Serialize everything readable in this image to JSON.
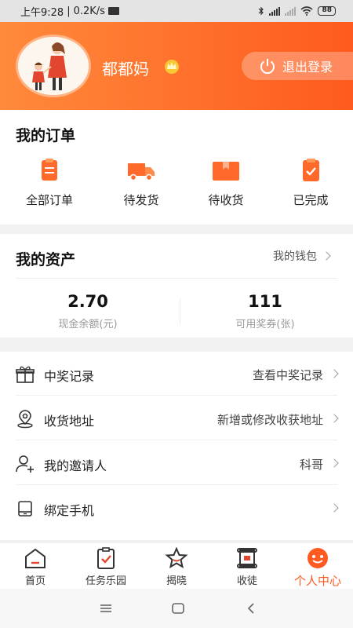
{
  "status_bar": {
    "time": "上午9:28",
    "speed": "0.2K/s",
    "battery": "88"
  },
  "profile": {
    "nickname": "都都妈",
    "logout_label": "退出登录"
  },
  "orders": {
    "title": "我的订单",
    "items": [
      {
        "label": "全部订单",
        "icon": "clipboard-icon"
      },
      {
        "label": "待发货",
        "icon": "truck-icon"
      },
      {
        "label": "待收货",
        "icon": "package-icon"
      },
      {
        "label": "已完成",
        "icon": "checklist-icon"
      }
    ]
  },
  "assets": {
    "title": "我的资产",
    "wallet_link": "我的钱包",
    "cash": {
      "value": "2.70",
      "label": "现金余额(元)"
    },
    "coupons": {
      "value": "111",
      "label": "可用奖券(张)"
    }
  },
  "menu": [
    {
      "label": "中奖记录",
      "value": "查看中奖记录",
      "icon": "gift-icon"
    },
    {
      "label": "收货地址",
      "value": "新增或修改收获地址",
      "icon": "location-icon"
    },
    {
      "label": "我的邀请人",
      "value": "科哥",
      "icon": "add-user-icon"
    },
    {
      "label": "绑定手机",
      "value": "",
      "icon": "phone-icon"
    }
  ],
  "tabs": [
    {
      "label": "首页",
      "icon": "home-icon"
    },
    {
      "label": "任务乐园",
      "icon": "task-icon"
    },
    {
      "label": "揭晓",
      "icon": "star-icon"
    },
    {
      "label": "收徒",
      "icon": "scroll-icon"
    },
    {
      "label": "个人中心",
      "icon": "profile-icon",
      "active": true
    }
  ],
  "colors": {
    "accent": "#ff5a1f",
    "header_start": "#ff8a3b",
    "header_end": "#ff5a1f"
  }
}
